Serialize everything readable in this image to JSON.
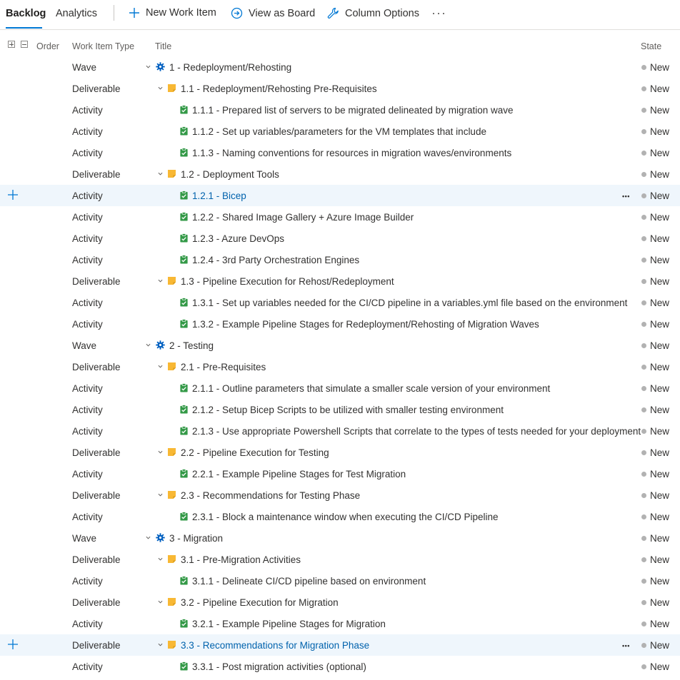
{
  "tabs": {
    "backlog": "Backlog",
    "analytics": "Analytics"
  },
  "commands": {
    "new_work_item": "New Work Item",
    "view_as_board": "View as Board",
    "column_options": "Column Options",
    "more": "···"
  },
  "columns": {
    "order": "Order",
    "type": "Work Item Type",
    "title": "Title",
    "state": "State"
  },
  "colors": {
    "accent": "#0078d4",
    "wave_gear": "#0060c0",
    "deliverable": "#f8b834",
    "activity": "#339947",
    "state_new": "#b2b2b2",
    "selected_row": "#eff6fc"
  },
  "rows": [
    {
      "type": "Wave",
      "level": 0,
      "kind": "wave",
      "title": "1 - Redeployment/Rehosting",
      "state": "New"
    },
    {
      "type": "Deliverable",
      "level": 1,
      "kind": "deliverable",
      "title": "1.1 - Redeployment/Rehosting Pre-Requisites",
      "state": "New"
    },
    {
      "type": "Activity",
      "level": 2,
      "kind": "activity",
      "title": "1.1.1 - Prepared list of servers to be migrated delineated by migration wave",
      "state": "New"
    },
    {
      "type": "Activity",
      "level": 2,
      "kind": "activity",
      "title": "1.1.2 - Set up variables/parameters for the VM templates that include",
      "state": "New"
    },
    {
      "type": "Activity",
      "level": 2,
      "kind": "activity",
      "title": "1.1.3 - Naming conventions for resources in migration waves/environments",
      "state": "New"
    },
    {
      "type": "Deliverable",
      "level": 1,
      "kind": "deliverable",
      "title": "1.2 - Deployment Tools",
      "state": "New"
    },
    {
      "type": "Activity",
      "level": 2,
      "kind": "activity",
      "title": "1.2.1 - Bicep",
      "state": "New",
      "selected": true
    },
    {
      "type": "Activity",
      "level": 2,
      "kind": "activity",
      "title": "1.2.2 - Shared Image Gallery + Azure Image Builder",
      "state": "New"
    },
    {
      "type": "Activity",
      "level": 2,
      "kind": "activity",
      "title": "1.2.3 - Azure DevOps",
      "state": "New"
    },
    {
      "type": "Activity",
      "level": 2,
      "kind": "activity",
      "title": "1.2.4 - 3rd Party Orchestration Engines",
      "state": "New"
    },
    {
      "type": "Deliverable",
      "level": 1,
      "kind": "deliverable",
      "title": "1.3 - Pipeline Execution for Rehost/Redeployment",
      "state": "New"
    },
    {
      "type": "Activity",
      "level": 2,
      "kind": "activity",
      "title": "1.3.1 - Set up variables needed for the CI/CD pipeline in a variables.yml file based on the environment",
      "state": "New"
    },
    {
      "type": "Activity",
      "level": 2,
      "kind": "activity",
      "title": "1.3.2 - Example Pipeline Stages for Redeployment/Rehosting of Migration Waves",
      "state": "New"
    },
    {
      "type": "Wave",
      "level": 0,
      "kind": "wave",
      "title": "2 - Testing",
      "state": "New"
    },
    {
      "type": "Deliverable",
      "level": 1,
      "kind": "deliverable",
      "title": "2.1 - Pre-Requisites",
      "state": "New"
    },
    {
      "type": "Activity",
      "level": 2,
      "kind": "activity",
      "title": "2.1.1 - Outline parameters that simulate a smaller scale version of your environment",
      "state": "New"
    },
    {
      "type": "Activity",
      "level": 2,
      "kind": "activity",
      "title": "2.1.2 - Setup Bicep Scripts to be utilized with smaller testing environment",
      "state": "New"
    },
    {
      "type": "Activity",
      "level": 2,
      "kind": "activity",
      "title": "2.1.3 - Use appropriate Powershell Scripts that correlate to the types of tests needed for your deployment",
      "state": "New"
    },
    {
      "type": "Deliverable",
      "level": 1,
      "kind": "deliverable",
      "title": "2.2 - Pipeline Execution for Testing",
      "state": "New"
    },
    {
      "type": "Activity",
      "level": 2,
      "kind": "activity",
      "title": "2.2.1 - Example Pipeline Stages for Test Migration",
      "state": "New"
    },
    {
      "type": "Deliverable",
      "level": 1,
      "kind": "deliverable",
      "title": "2.3 - Recommendations for Testing Phase",
      "state": "New"
    },
    {
      "type": "Activity",
      "level": 2,
      "kind": "activity",
      "title": "2.3.1 - Block a maintenance window when executing the CI/CD Pipeline",
      "state": "New"
    },
    {
      "type": "Wave",
      "level": 0,
      "kind": "wave",
      "title": "3 - Migration",
      "state": "New"
    },
    {
      "type": "Deliverable",
      "level": 1,
      "kind": "deliverable",
      "title": "3.1 - Pre-Migration Activities",
      "state": "New"
    },
    {
      "type": "Activity",
      "level": 2,
      "kind": "activity",
      "title": "3.1.1 - Delineate CI/CD pipeline based on environment",
      "state": "New"
    },
    {
      "type": "Deliverable",
      "level": 1,
      "kind": "deliverable",
      "title": "3.2 - Pipeline Execution for Migration",
      "state": "New"
    },
    {
      "type": "Activity",
      "level": 2,
      "kind": "activity",
      "title": "3.2.1 - Example Pipeline Stages for Migration",
      "state": "New"
    },
    {
      "type": "Deliverable",
      "level": 1,
      "kind": "deliverable",
      "title": "3.3 - Recommendations for Migration Phase",
      "state": "New",
      "selected": true
    },
    {
      "type": "Activity",
      "level": 2,
      "kind": "activity",
      "title": "3.3.1 - Post migration activities (optional)",
      "state": "New"
    }
  ]
}
